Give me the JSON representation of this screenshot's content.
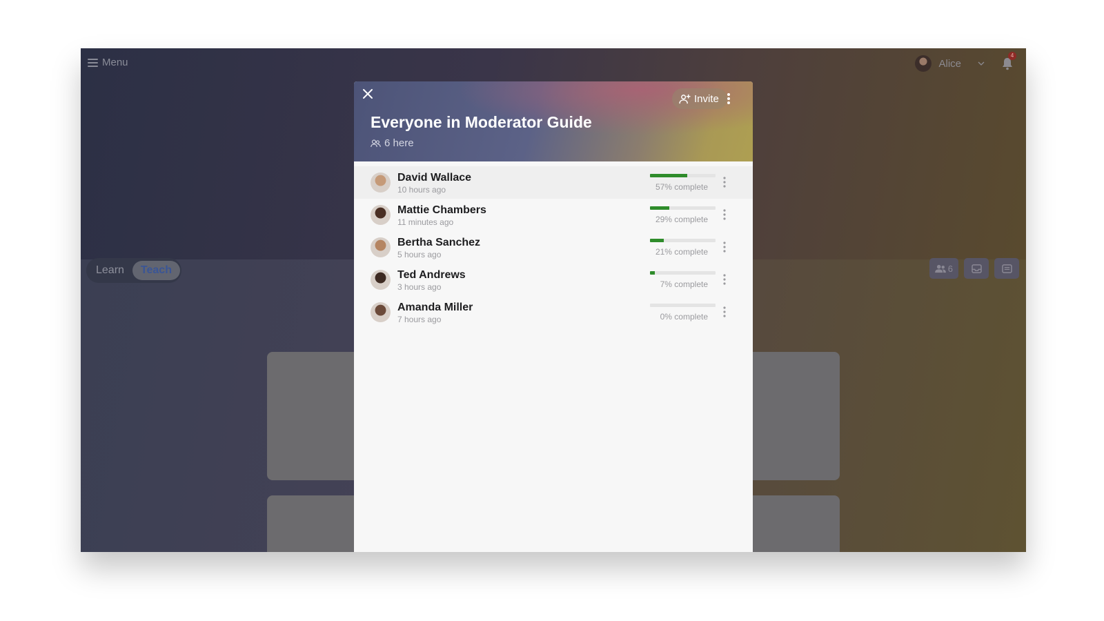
{
  "app": {
    "menu_label": "Menu",
    "user_name": "Alice",
    "notification_count": "4",
    "tabs": [
      {
        "label": "Learn",
        "active": false
      },
      {
        "label": "Teach",
        "active": true
      }
    ],
    "participants_count": "6"
  },
  "modal": {
    "title": "Everyone in Moderator Guide",
    "here_text": "6 here",
    "invite_label": "Invite",
    "members": [
      {
        "name": "David Wallace",
        "time": "10 hours ago",
        "progress": 57,
        "progress_label": "57% complete",
        "avatar_color": "#c59a78"
      },
      {
        "name": "Mattie Chambers",
        "time": "11 minutes ago",
        "progress": 29,
        "progress_label": "29% complete",
        "avatar_color": "#4a2f24"
      },
      {
        "name": "Bertha Sanchez",
        "time": "5 hours ago",
        "progress": 21,
        "progress_label": "21% complete",
        "avatar_color": "#b58562"
      },
      {
        "name": "Ted Andrews",
        "time": "3 hours ago",
        "progress": 7,
        "progress_label": "7% complete",
        "avatar_color": "#3d2a22"
      },
      {
        "name": "Amanda Miller",
        "time": "7 hours ago",
        "progress": 0,
        "progress_label": "0% complete",
        "avatar_color": "#6b4a3a"
      }
    ]
  },
  "colors": {
    "progress_fill": "#2f8c2b",
    "progress_track": "#e4e4e4",
    "active_tab_text": "#3a5596"
  }
}
